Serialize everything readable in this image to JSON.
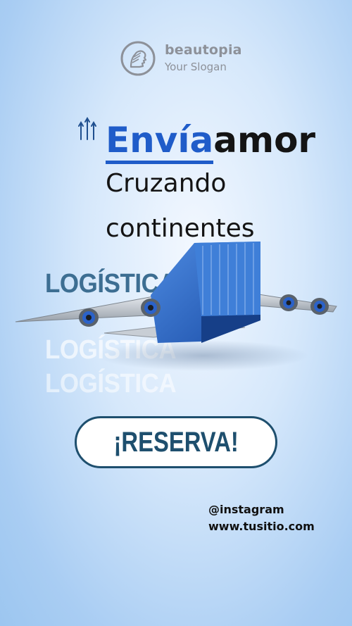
{
  "brand": {
    "name": "beautopia",
    "slogan": "Your Slogan",
    "logo_icon": "helmet-head-icon"
  },
  "headline": {
    "highlight": "Envía",
    "rest": "amor",
    "line2": "Cruzando",
    "line3": "continentes"
  },
  "logistics": {
    "word1": "LOGÍSTICA",
    "word2": "LOGÍSTICA",
    "word3": "LOGÍSTICA"
  },
  "cta": {
    "label": "¡RESERVA!"
  },
  "contact": {
    "instagram": "@instagram",
    "website": "www.tusitio.com"
  },
  "colors": {
    "accent": "#1f5cc9",
    "button_border": "#1e4f6e",
    "logistics_text": "#3d6e92",
    "container": "#2a62c4"
  }
}
